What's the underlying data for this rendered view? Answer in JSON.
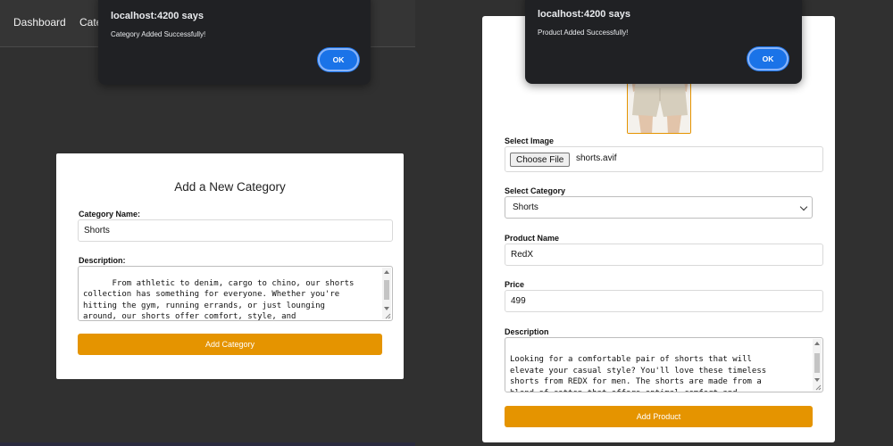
{
  "left": {
    "nav": {
      "dashboard": "Dashboard",
      "categories": "Cate"
    },
    "dialog": {
      "title": "localhost:4200 says",
      "message": "Category Added Successfully!",
      "ok": "OK"
    },
    "form": {
      "title": "Add a New Category",
      "name_label": "Category Name:",
      "name_value": "Shorts",
      "desc_label": "Description:",
      "desc_value": "From athletic to denim, cargo to chino, our shorts\ncollection has something for everyone. Whether you're\nhitting the gym, running errands, or just lounging\naround, our shorts offer comfort, style, and\nversatility for any occasion.",
      "submit": "Add Category"
    }
  },
  "right": {
    "dialog": {
      "title": "localhost:4200 says",
      "message": "Product Added Successfully!",
      "ok": "OK"
    },
    "form": {
      "image_label": "Select Image",
      "choose_file": "Choose File",
      "file_name": "shorts.avif",
      "category_label": "Select Category",
      "category_value": "Shorts",
      "name_label": "Product Name",
      "name_value": "RedX",
      "price_label": "Price",
      "price_value": "499",
      "desc_label": "Description",
      "desc_value": "Looking for a comfortable pair of shorts that will\nelevate your casual style? You'll love these timeless\nshorts from REDX for men. The shorts are made from a\nblend of cotton that offers optimal comfort and\ndurability.",
      "submit": "Add Product"
    }
  },
  "colors": {
    "accent": "#e59400",
    "dialog_bg": "#202124",
    "ok_button": "#1a73e8",
    "backdrop": "#303030"
  }
}
